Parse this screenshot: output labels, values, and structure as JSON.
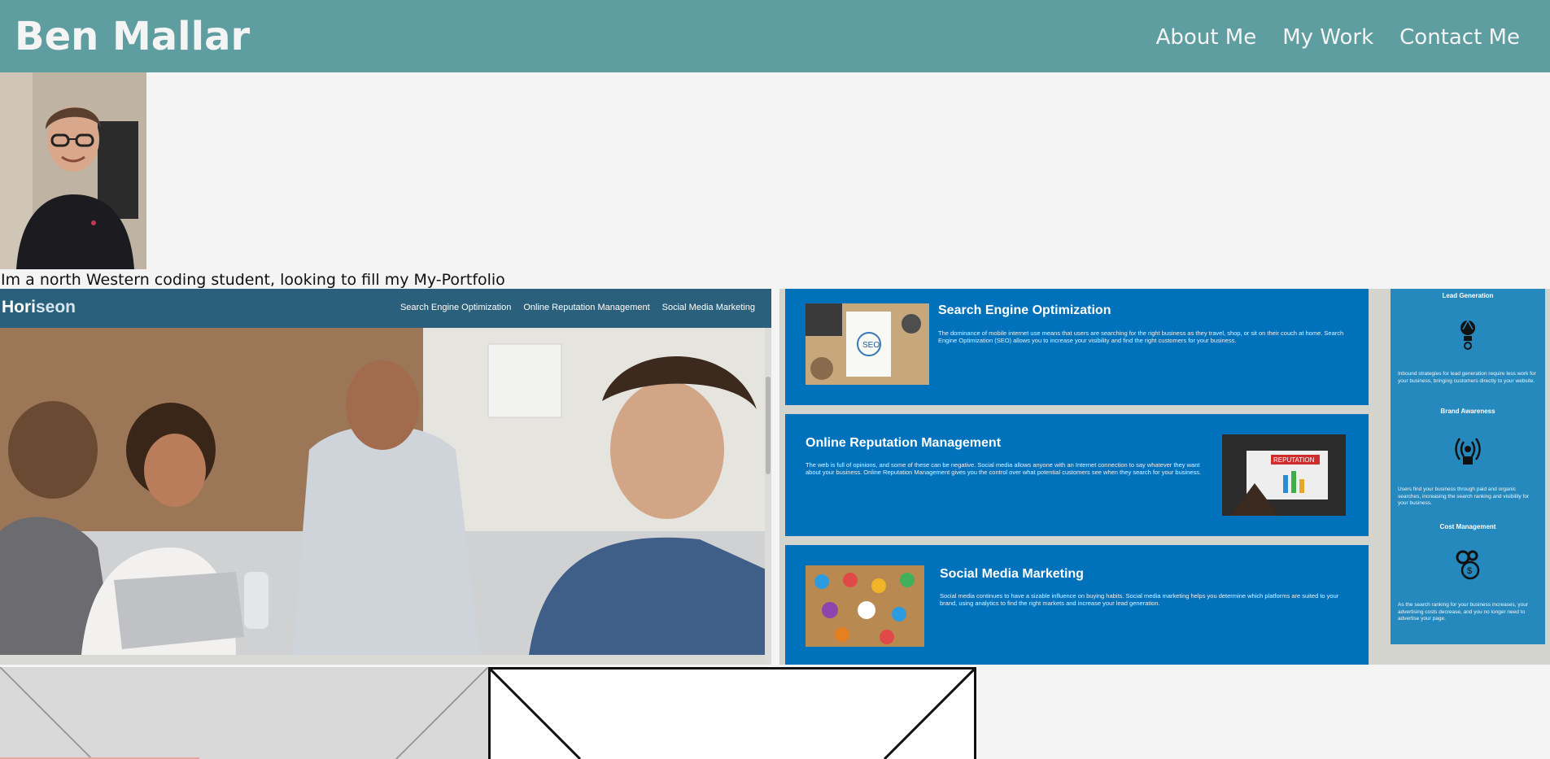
{
  "header": {
    "title": "Ben Mallar",
    "nav": [
      "About Me",
      "My Work",
      "Contact Me"
    ]
  },
  "profile": {
    "bio": "Im a north Western coding student, looking to fill my My-Portfolio"
  },
  "work": {
    "horiseon": {
      "brand_a": "Hori",
      "brand_b": "seon",
      "nav": [
        "Search Engine Optimization",
        "Online Reputation Management",
        "Social Media Marketing"
      ]
    },
    "cards": [
      {
        "title": "Search Engine Optimization",
        "text": "The dominance of mobile internet use means that users are searching for the right business as they travel, shop, or sit on their couch at home. Search Engine Optimization (SEO) allows you to increase your visibility and find the right customers for your business."
      },
      {
        "title": "Online Reputation Management",
        "text": "The web is full of opinions, and some of these can be negative. Social media allows anyone with an Internet connection to say whatever they want about your business. Online Reputation Management gives you the control over what potential customers see when they search for your business."
      },
      {
        "title": "Social Media Marketing",
        "text": "Social media continues to have a sizable influence on buying habits. Social media marketing helps you determine which platforms are suited to your brand, using analytics to find the right markets and increase your lead generation."
      }
    ],
    "benefits": [
      {
        "title": "Lead Generation",
        "icon": "lightbulb-icon",
        "text": "Inbound strategies for lead generation require less work for your business, bringing customers directly to your website."
      },
      {
        "title": "Brand Awareness",
        "icon": "broadcast-icon",
        "text": "Users find your business through paid and organic searches, increasing the search ranking and visibility for your business."
      },
      {
        "title": "Cost Management",
        "icon": "gears-dollar-icon",
        "text": "As the search ranking for your business increases, your advertising costs decrease, and you no longer need to advertise your page."
      }
    ],
    "reputation_badge": "REPUTATION",
    "seo_badge": "SEO"
  },
  "colors": {
    "header_bg": "#5f9ea0",
    "horiseon_nav": "#2a607c",
    "card_blue": "#0072bb",
    "side_blue": "#2589bd"
  }
}
